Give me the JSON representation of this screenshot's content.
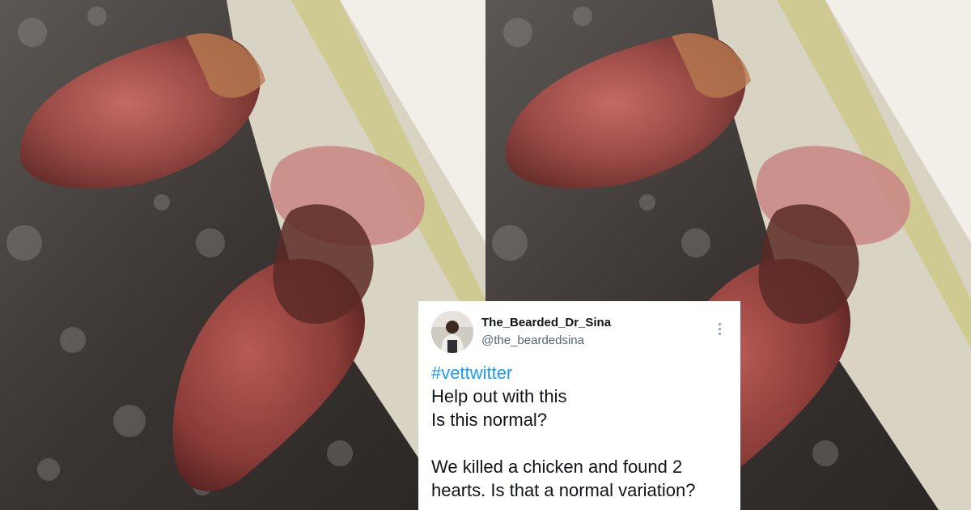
{
  "tweet": {
    "display_name": "The_Bearded_Dr_Sina",
    "handle": "@the_beardedsina",
    "hashtag": "#vettwitter",
    "lines": [
      "Help out with this",
      "Is this normal?"
    ],
    "lines_after_break": [
      "We killed a chicken and found 2",
      "hearts. Is that a normal variation?"
    ]
  },
  "colors": {
    "hashtag": "#1d9bf0",
    "text": "#0f1419",
    "handle": "#536471",
    "card_bg": "#ffffff"
  },
  "icons": [
    "more-options-icon"
  ],
  "photo": {
    "count": 2
  }
}
